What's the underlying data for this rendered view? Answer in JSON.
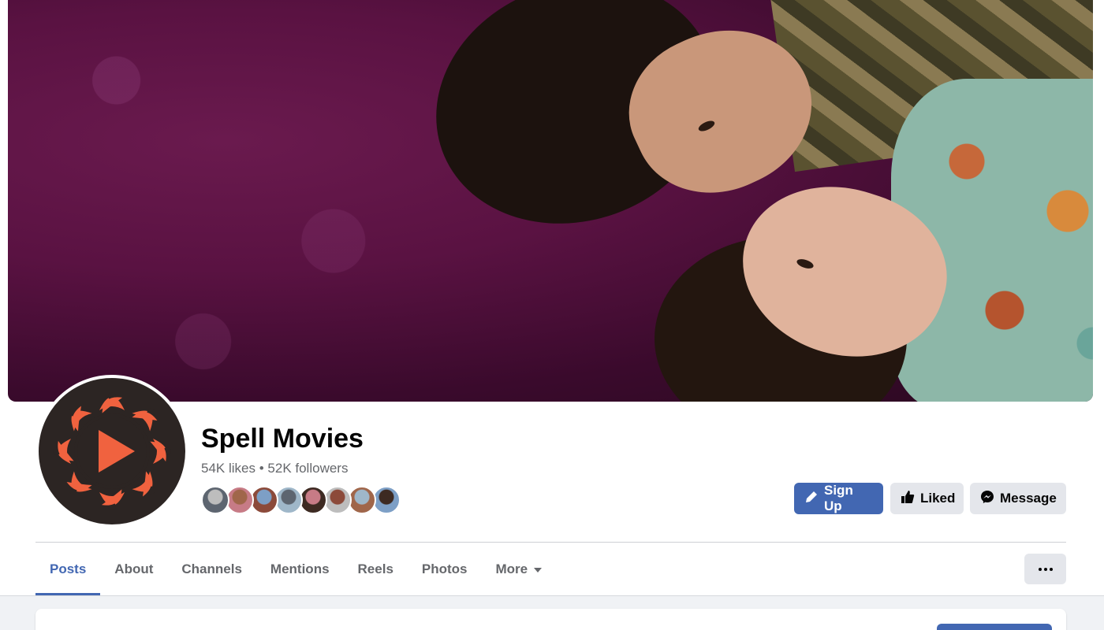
{
  "page": {
    "name": "Spell Movies",
    "likes": "54K likes",
    "separator": "•",
    "followers": "52K followers"
  },
  "actions": {
    "sign_up": "Sign Up",
    "liked": "Liked",
    "message": "Message"
  },
  "tabs": [
    {
      "label": "Posts",
      "active": true
    },
    {
      "label": "About",
      "active": false
    },
    {
      "label": "Channels",
      "active": false
    },
    {
      "label": "Mentions",
      "active": false
    },
    {
      "label": "Reels",
      "active": false
    },
    {
      "label": "Photos",
      "active": false
    },
    {
      "label": "More",
      "active": false
    }
  ],
  "friend_avatar_count": 8,
  "colors": {
    "brand_blue": "#4267b2",
    "logo_orange": "#f0623f",
    "logo_dark": "#2c2523",
    "cover_purple": "#5a1242",
    "secondary_button": "#e4e6eb"
  },
  "icons": {
    "sign_up": "pencil-icon",
    "liked": "thumbs-up-icon",
    "message": "messenger-icon",
    "more_tab": "caret-down-icon",
    "options": "more-dots-icon",
    "logo": "play-icon"
  }
}
